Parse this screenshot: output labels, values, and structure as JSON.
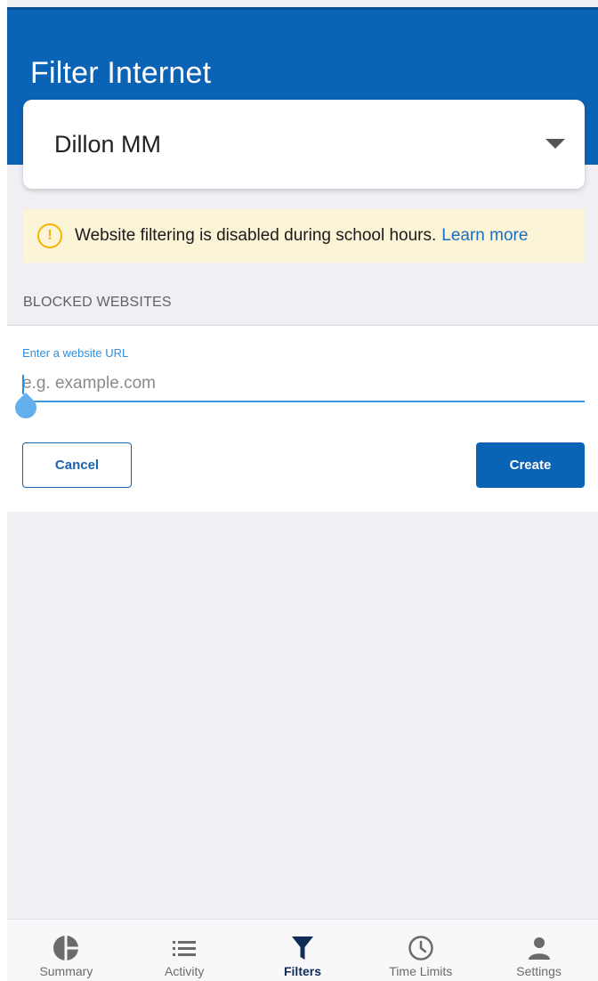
{
  "header": {
    "title": "Filter Internet"
  },
  "selector": {
    "selected_name": "Dillon MM"
  },
  "notice": {
    "text": "Website filtering is disabled during school hours.",
    "link_label": "Learn more",
    "icon": "warning-circle-icon",
    "color": "#f4b400"
  },
  "blocked_websites": {
    "section_title": "BLOCKED WEBSITES",
    "input_label": "Enter a website URL",
    "input_placeholder": "e.g. example.com",
    "input_value": "",
    "cancel_label": "Cancel",
    "create_label": "Create"
  },
  "bottom_nav": {
    "items": [
      {
        "label": "Summary",
        "icon": "pie-chart-icon",
        "active": false
      },
      {
        "label": "Activity",
        "icon": "list-icon",
        "active": false
      },
      {
        "label": "Filters",
        "icon": "filter-icon",
        "active": true
      },
      {
        "label": "Time Limits",
        "icon": "clock-icon",
        "active": false
      },
      {
        "label": "Settings",
        "icon": "person-icon",
        "active": false
      }
    ]
  },
  "colors": {
    "brand": "#0b63b6",
    "accent": "#2d8fe0",
    "active_nav": "#0f2d56"
  }
}
